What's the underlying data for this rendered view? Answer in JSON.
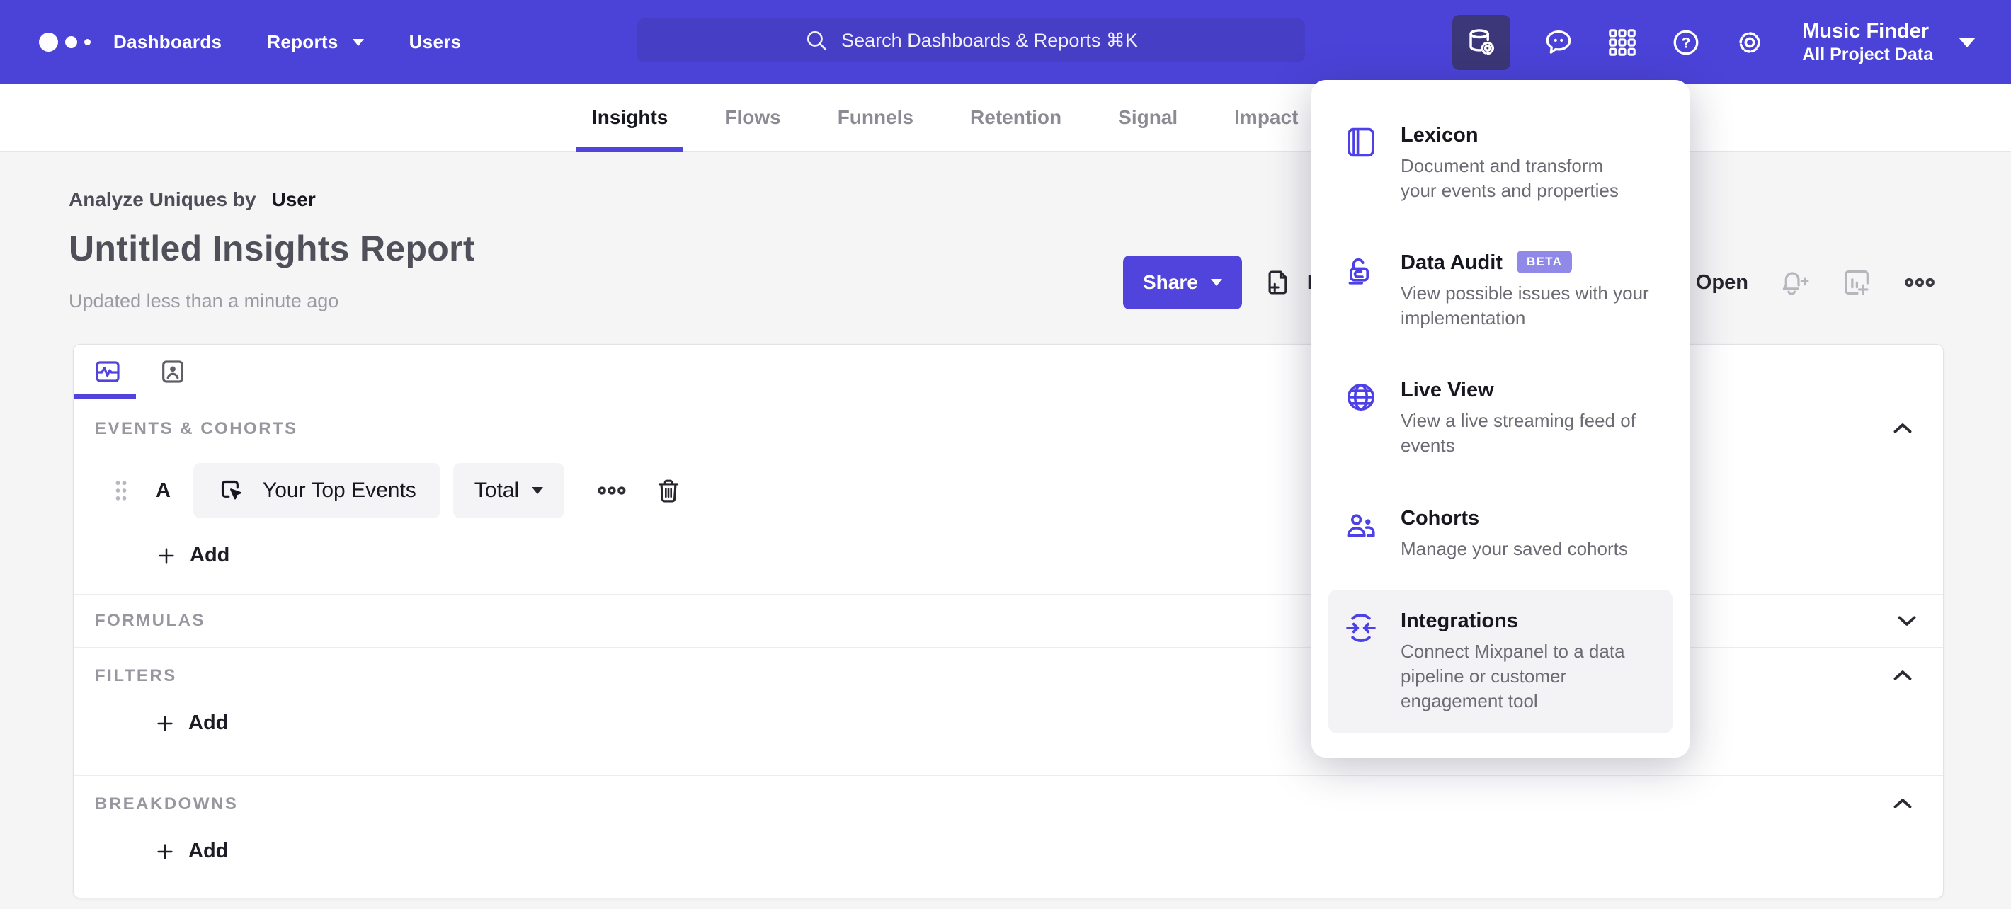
{
  "colors": {
    "navbar": "#4b43d8",
    "accent": "#5144dc",
    "menu_icon_purple": "#4c40e6",
    "beta_badge": "#9189e8",
    "search_field": "#463ec4",
    "active_tile": "#3b3778",
    "page_bg": "#f5f5f6"
  },
  "navbar": {
    "links": [
      "Dashboards",
      "Reports",
      "Users"
    ],
    "search_placeholder": "Search Dashboards & Reports ⌘K",
    "project_name": "Music Finder",
    "project_scope": "All Project Data"
  },
  "tabbar": {
    "tabs": [
      "Insights",
      "Flows",
      "Funnels",
      "Retention",
      "Signal",
      "Impact"
    ],
    "active_tab": "Insights"
  },
  "header": {
    "analyze_label": "Analyze Uniques by",
    "analyze_value": "User",
    "title": "Untitled Insights Report",
    "updated": "Updated less than a minute ago",
    "share_label": "Share",
    "new_label": "New",
    "open_label": "Open"
  },
  "builder": {
    "events_label": "EVENTS & COHORTS",
    "series_letter": "A",
    "event_name": "Your Top Events",
    "metric_label": "Total",
    "add_label": "Add",
    "formulas_label": "FORMULAS",
    "filters_label": "FILTERS",
    "breakdowns_label": "BREAKDOWNS"
  },
  "menu": {
    "items": [
      {
        "title": "Lexicon",
        "desc": "Document and transform\nyour events and properties"
      },
      {
        "title": "Data Audit",
        "badge": "BETA",
        "desc": "View possible issues with your\nimplementation"
      },
      {
        "title": "Live View",
        "desc": "View a live streaming feed of\nevents"
      },
      {
        "title": "Cohorts",
        "desc": "Manage your saved cohorts"
      },
      {
        "title": "Integrations",
        "desc": "Connect Mixpanel to a data\npipeline or customer\nengagement tool"
      }
    ]
  }
}
